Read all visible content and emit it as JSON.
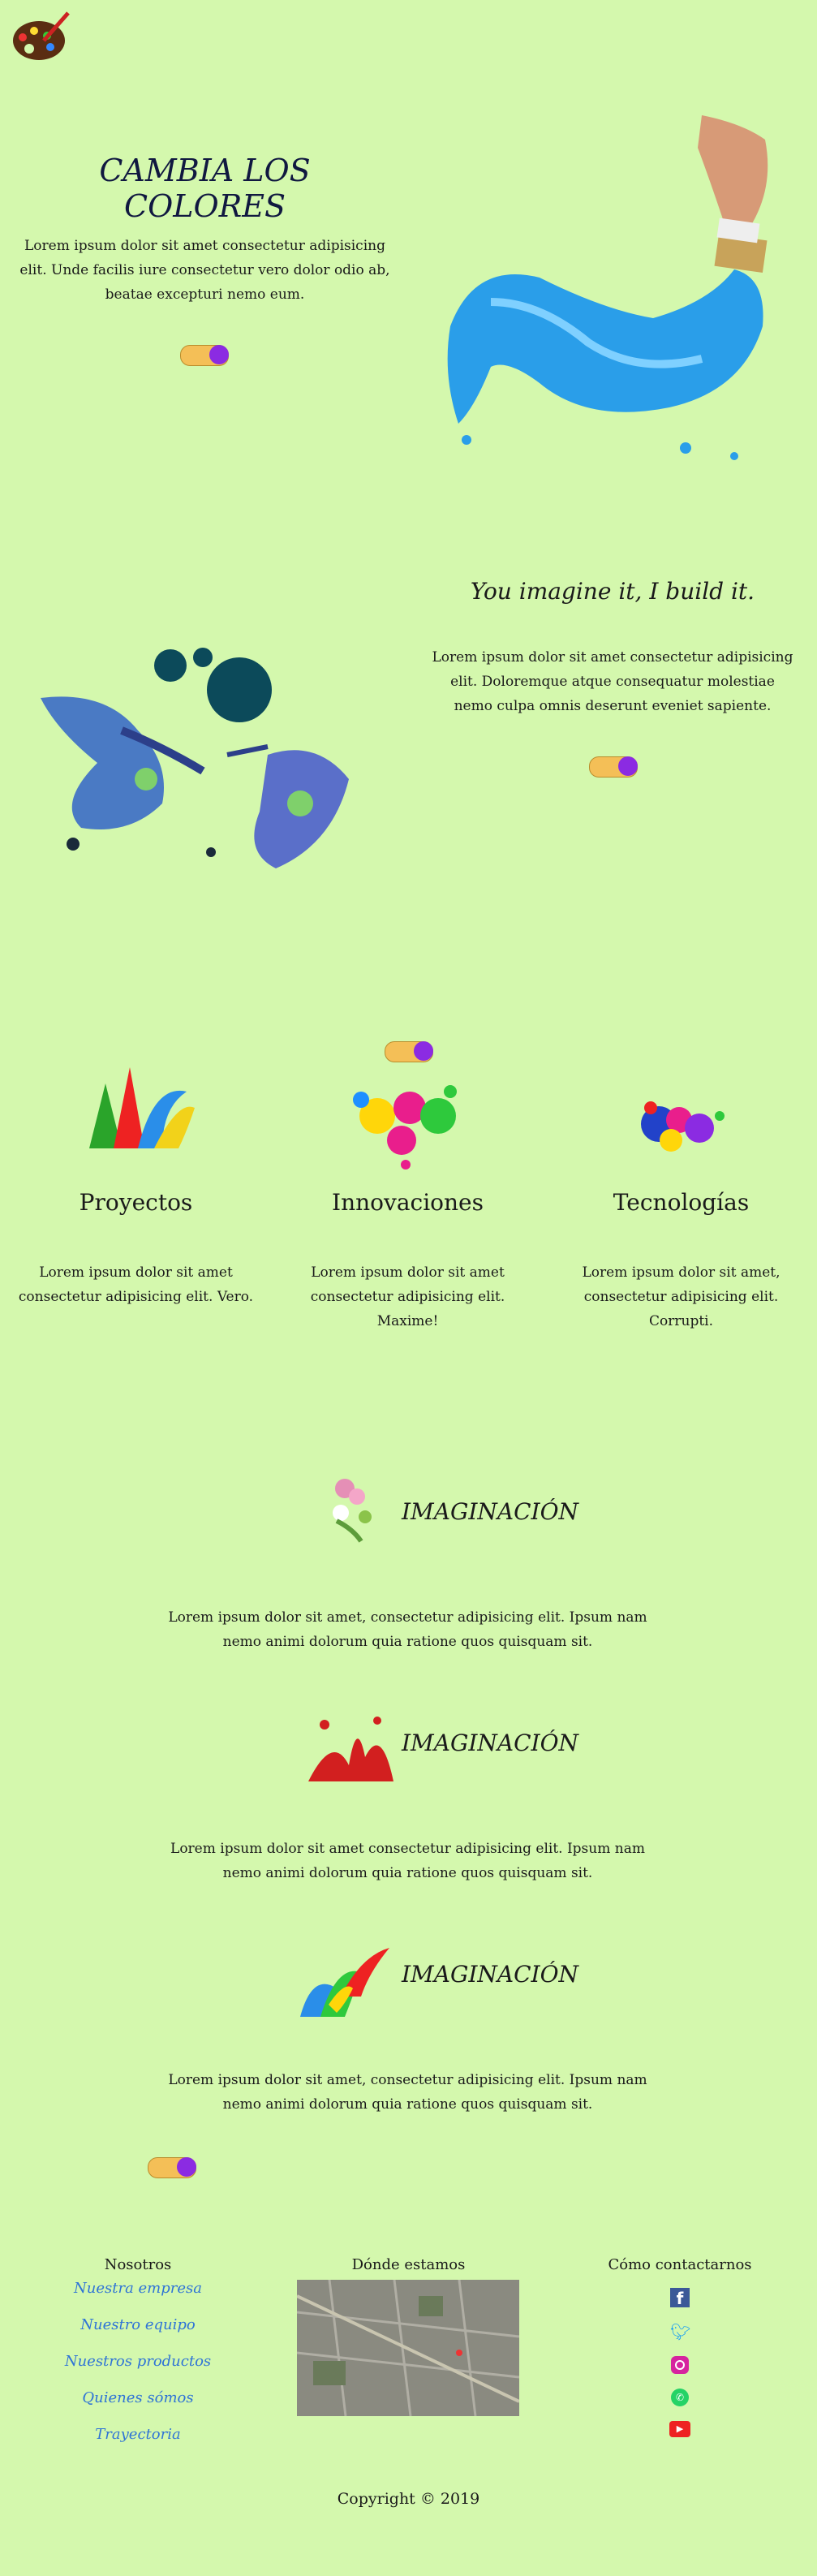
{
  "hero": {
    "title": "CAMBIA LOS COLORES",
    "text": "Lorem ipsum dolor sit amet consectetur adipisicing elit. Unde facilis iure consectetur vero dolor odio ab, beatae excepturi nemo eum."
  },
  "second": {
    "title": "You imagine it, I build it.",
    "text": "Lorem ipsum dolor sit amet consectetur adipisicing elit. Doloremque atque consequatur molestiae nemo culpa omnis deserunt eveniet sapiente."
  },
  "cards": [
    {
      "title": "Proyectos",
      "text": "Lorem ipsum dolor sit amet consectetur adipisicing elit. Vero."
    },
    {
      "title": "Innovaciones",
      "text": "Lorem ipsum dolor sit amet consectetur adipisicing elit. Maxime!"
    },
    {
      "title": "Tecnologías",
      "text": "Lorem ipsum dolor sit amet, consectetur adipisicing elit. Corrupti."
    }
  ],
  "features": [
    {
      "title": "IMAGINACIÓN",
      "text": "Lorem ipsum dolor sit amet, consectetur adipisicing elit. Ipsum nam nemo animi dolorum quia ratione quos quisquam sit."
    },
    {
      "title": "IMAGINACIÓN",
      "text": "Lorem ipsum dolor sit amet consectetur adipisicing elit. Ipsum nam nemo animi dolorum quia ratione quos quisquam sit."
    },
    {
      "title": "IMAGINACIÓN",
      "text": "Lorem ipsum dolor sit amet, consectetur adipisicing elit. Ipsum nam nemo animi dolorum quia ratione quos quisquam sit."
    }
  ],
  "footer": {
    "col1_title": "Nosotros",
    "links": [
      "Nuestra empresa",
      "Nuestro equipo",
      "Nuestros productos",
      "Quienes sómos",
      "Trayectoria"
    ],
    "col2_title": "Dónde estamos",
    "col3_title": "Cómo contactarnos",
    "social_icons": [
      "facebook-icon",
      "twitter-icon",
      "instagram-icon",
      "whatsapp-icon",
      "youtube-icon"
    ],
    "copyright": "Copyright © 2019"
  },
  "colors": {
    "background": "#d4f8ad",
    "toggle_track": "#f4bf57",
    "toggle_knob": "#8b2be2",
    "link": "#2f74d6"
  }
}
